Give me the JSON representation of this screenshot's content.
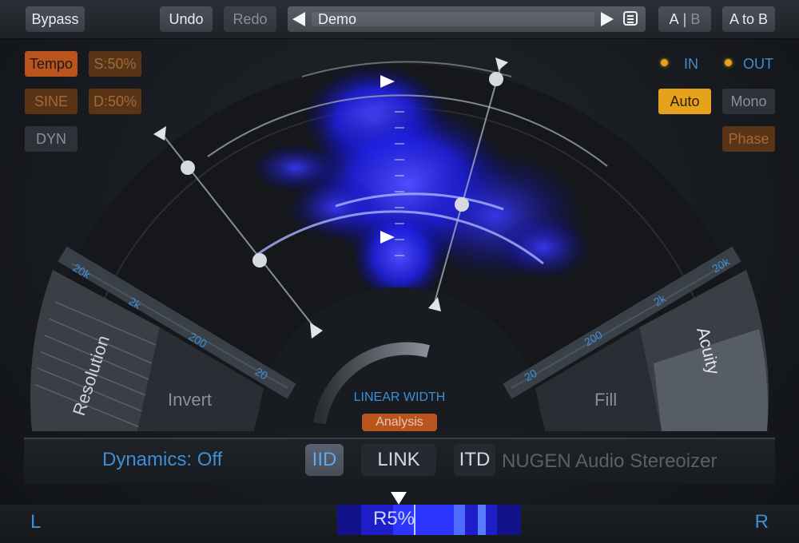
{
  "topbar": {
    "bypass_label": "Bypass",
    "undo_label": "Undo",
    "redo_label": "Redo",
    "preset_name": "Demo",
    "ab_a": "A",
    "ab_sep": "|",
    "ab_b": "B",
    "atob_label": "A to B"
  },
  "left_controls": {
    "tempo_label": "Tempo",
    "s_label": "S:50%",
    "sine_label": "SINE",
    "d_label": "D:50%",
    "dyn_label": "DYN"
  },
  "right_controls": {
    "in_label": "IN",
    "out_label": "OUT",
    "auto_label": "Auto",
    "mono_label": "Mono",
    "phase_label": "Phase"
  },
  "display": {
    "left_scale": [
      "20k",
      "2k",
      "200",
      "20"
    ],
    "right_scale": [
      "20",
      "200",
      "2k",
      "20k"
    ],
    "resolution_label": "Resolution",
    "invert_label": "Invert",
    "fill_label": "Fill",
    "acuity_label": "Acuity",
    "linear_width_label": "LINEAR WIDTH",
    "analysis_label": "Analysis"
  },
  "bottombar": {
    "dynamics_label": "Dynamics:",
    "dynamics_value": "Off",
    "iid_label": "IID",
    "link_label": "LINK",
    "itd_label": "ITD",
    "brand": "NUGEN Audio Stereoizer"
  },
  "meter": {
    "left_label": "L",
    "right_label": "R",
    "value_label": "R5%",
    "balance_percent": 5
  },
  "colors": {
    "accent_blue": "#3d8fd6",
    "orange": "#b8541c",
    "amber": "#e5a21a",
    "display_glow": "#2a2aff"
  }
}
